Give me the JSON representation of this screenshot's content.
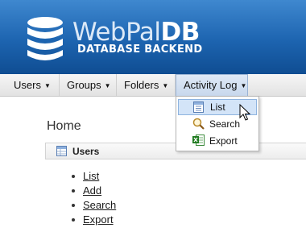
{
  "header": {
    "logo_text_light": "WebPal",
    "logo_text_bold": "DB",
    "tagline": "DATABASE BACKEND"
  },
  "nav": {
    "items": [
      {
        "label": "Users"
      },
      {
        "label": "Groups"
      },
      {
        "label": "Folders"
      },
      {
        "label": "Activity Log"
      }
    ]
  },
  "dropdown": {
    "items": [
      {
        "label": "List",
        "icon": "list-icon"
      },
      {
        "label": "Search",
        "icon": "search-icon"
      },
      {
        "label": "Export",
        "icon": "excel-export-icon"
      }
    ]
  },
  "main": {
    "title": "Home",
    "panel": {
      "title": "Users",
      "links": [
        "List",
        "Add",
        "Search",
        "Export"
      ]
    }
  }
}
